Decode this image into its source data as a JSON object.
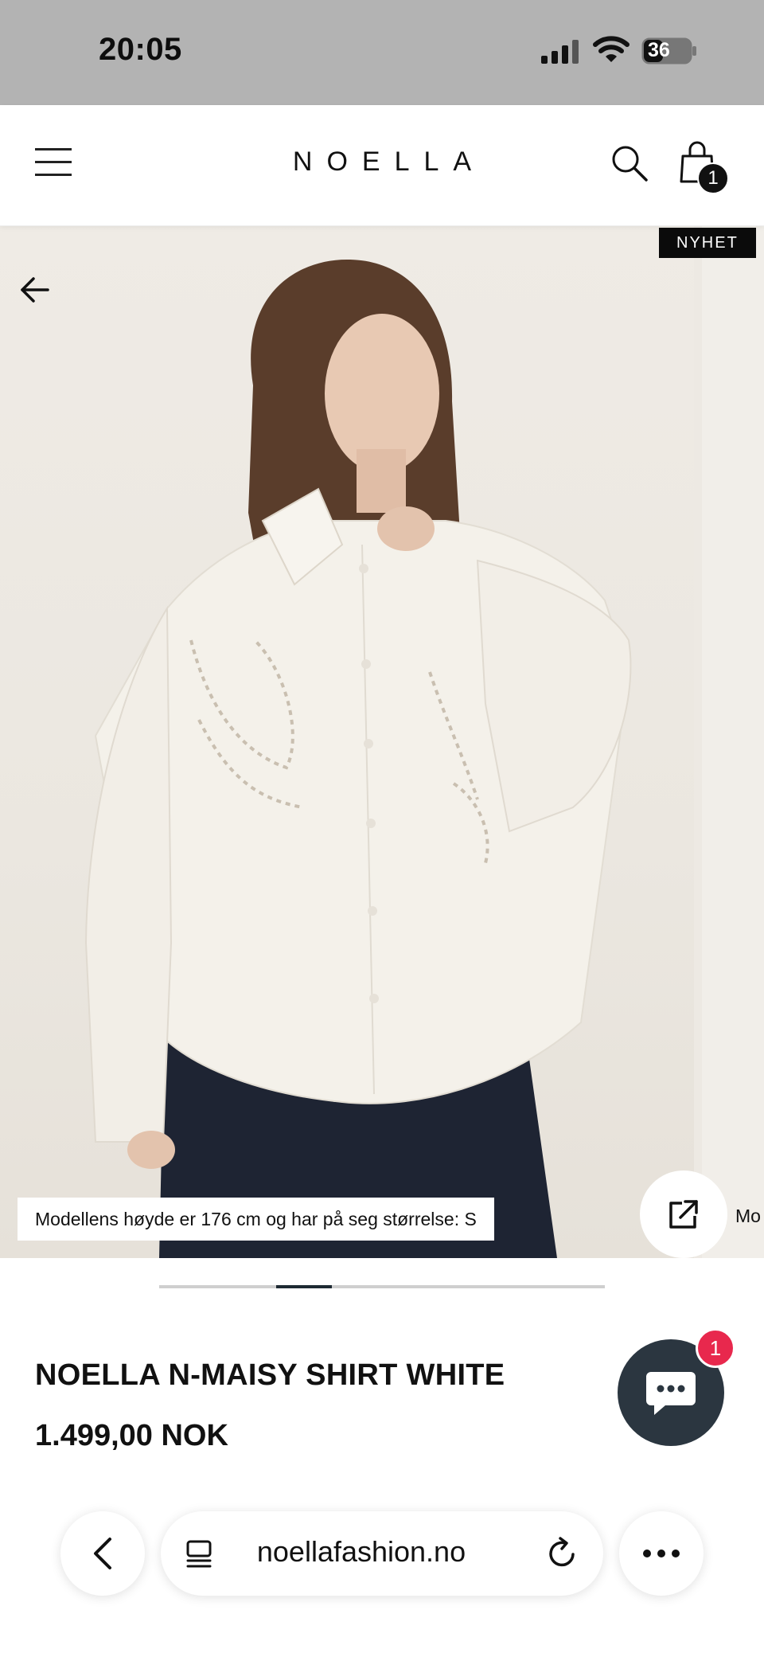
{
  "status_bar": {
    "time": "20:05",
    "battery": "36"
  },
  "header": {
    "logo": "NOELLA",
    "cart_count": "1",
    "icons": [
      "menu-icon",
      "search-icon",
      "shopping-bag-icon"
    ]
  },
  "gallery": {
    "badge": "NYHET",
    "model_caption": "Modellens høyde er 176 cm og har på seg størrelse: S",
    "next_caption": "Mo",
    "scroll_progress": 0.3,
    "icons": [
      "back-arrow-icon",
      "external-link-icon"
    ]
  },
  "product": {
    "title": "NOELLA N-MAISY SHIRT WHITE",
    "price": "1.499,00 NOK"
  },
  "chat": {
    "unread_count": "1",
    "icon": "chat-bubble-icon"
  },
  "browser": {
    "url": "noellafashion.no",
    "icons": [
      "chevron-left-icon",
      "tabs-icon",
      "reload-icon",
      "more-icon"
    ]
  }
}
